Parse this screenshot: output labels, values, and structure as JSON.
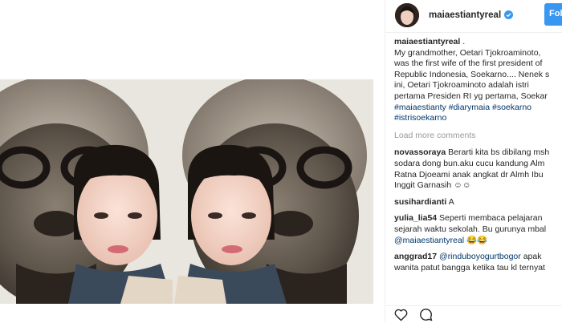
{
  "post": {
    "username": "maiaestiantyreal",
    "follow_label": "Follow"
  },
  "caption": {
    "username": "maiaestiantyreal",
    "suffix": ".",
    "lines": [
      "My grandmother, Oetari Tjokroaminoto,",
      "was the first wife of the first president of",
      "Republic Indonesia, Soekarno.... Nenek s",
      "ini, Oetari Tjokroaminoto adalah istri",
      "pertama Presiden RI yg pertama, Soekar"
    ],
    "hashtags_line1": "#maiaestianty #diarymaia #soekarno",
    "hashtags_line2": "#istrisoekarno"
  },
  "load_more": "Load more comments",
  "comments": [
    {
      "username": "novassoraya",
      "first": "Berarti kita bs dibilang msh",
      "lines": [
        "sodara dong bun.aku cucu kandung Alm",
        "Ratna Djoeami anak angkat dr Almh Ibu",
        "Inggit Garnasih ☺☺"
      ]
    },
    {
      "username": "susihardianti",
      "first": "A",
      "lines": []
    },
    {
      "username": "yulia_lia54",
      "first": "Seperti membaca pelajaran",
      "lines": [
        "sejarah waktu sekolah. Bu gurunya mbal"
      ],
      "mention": "@maiaestiantyreal",
      "mention_suffix": " 😂😂"
    },
    {
      "username": "anggrad17",
      "first_mention": "@rinduboyogurtbogor",
      "first": " apak",
      "lines": [
        "wanita patut bangga ketika tau kl ternyat"
      ]
    }
  ],
  "colors": {
    "link": "#003569",
    "muted": "#999999",
    "follow": "#3897f0",
    "verified": "#3897f0"
  },
  "icons": [
    "heart-icon",
    "comment-icon",
    "verified-badge-icon"
  ]
}
